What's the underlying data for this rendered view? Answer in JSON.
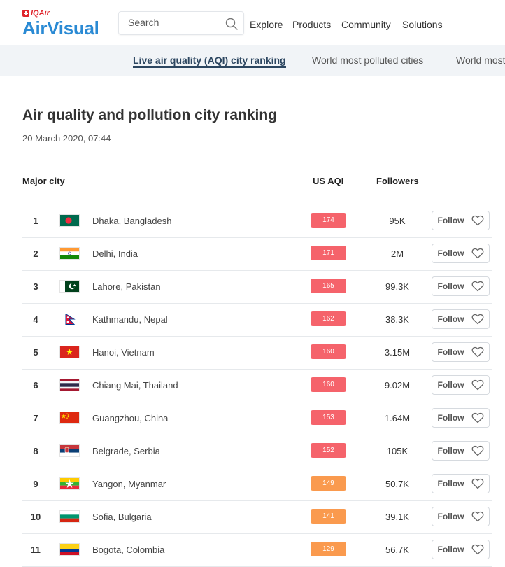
{
  "header": {
    "brand_small": "IQAir",
    "brand_main": "AirVisual",
    "search_placeholder": "Search",
    "nav": [
      "Explore",
      "Products",
      "Community",
      "Solutions"
    ]
  },
  "subnav": {
    "items": [
      "Live air quality (AQI) city ranking",
      "World most polluted cities",
      "World most"
    ]
  },
  "page": {
    "title": "Air quality and pollution city ranking",
    "date": "20 March 2020, 07:44"
  },
  "table": {
    "headers": {
      "city": "Major city",
      "aqi": "US AQI",
      "followers": "Followers"
    },
    "follow_label": "Follow",
    "rows": [
      {
        "rank": "1",
        "city": "Dhaka, Bangladesh",
        "aqi": "174",
        "followers": "95K",
        "flag": "bangladesh"
      },
      {
        "rank": "2",
        "city": "Delhi, India",
        "aqi": "171",
        "followers": "2M",
        "flag": "india"
      },
      {
        "rank": "3",
        "city": "Lahore, Pakistan",
        "aqi": "165",
        "followers": "99.3K",
        "flag": "pakistan"
      },
      {
        "rank": "4",
        "city": "Kathmandu, Nepal",
        "aqi": "162",
        "followers": "38.3K",
        "flag": "nepal"
      },
      {
        "rank": "5",
        "city": "Hanoi, Vietnam",
        "aqi": "160",
        "followers": "3.15M",
        "flag": "vietnam"
      },
      {
        "rank": "6",
        "city": "Chiang Mai, Thailand",
        "aqi": "160",
        "followers": "9.02M",
        "flag": "thailand"
      },
      {
        "rank": "7",
        "city": "Guangzhou, China",
        "aqi": "153",
        "followers": "1.64M",
        "flag": "china"
      },
      {
        "rank": "8",
        "city": "Belgrade, Serbia",
        "aqi": "152",
        "followers": "105K",
        "flag": "serbia"
      },
      {
        "rank": "9",
        "city": "Yangon, Myanmar",
        "aqi": "149",
        "followers": "50.7K",
        "flag": "myanmar"
      },
      {
        "rank": "10",
        "city": "Sofia, Bulgaria",
        "aqi": "141",
        "followers": "39.1K",
        "flag": "bulgaria"
      },
      {
        "rank": "11",
        "city": "Bogota, Colombia",
        "aqi": "129",
        "followers": "56.7K",
        "flag": "colombia"
      }
    ]
  },
  "colors": {
    "brand_blue": "#2a8ad4",
    "brand_red": "#e0252c",
    "aqi_unhealthy": "#f5636b",
    "aqi_sensitive": "#fa9a4e",
    "active_tab": "#2c4660"
  }
}
